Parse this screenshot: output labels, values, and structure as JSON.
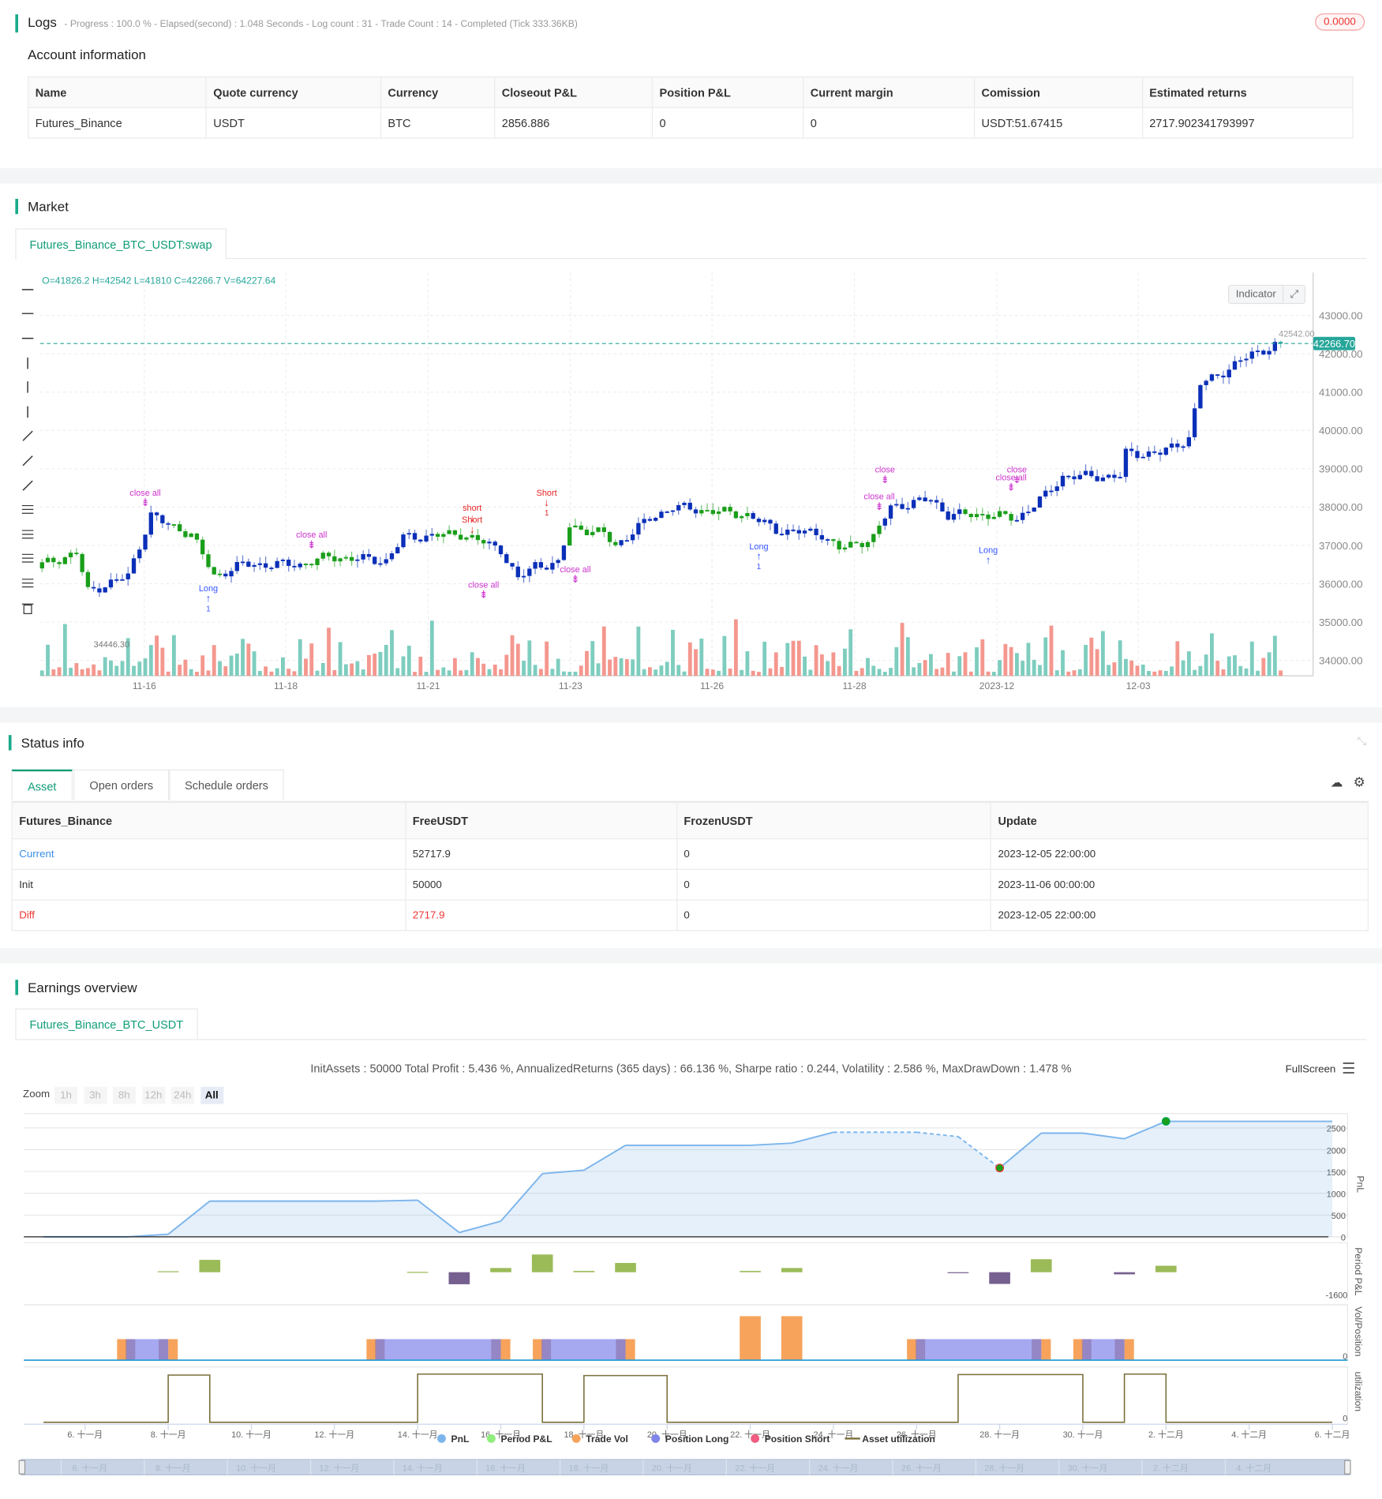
{
  "logs": {
    "title": "Logs",
    "summary": "- Progress : 100.0 % - Elapsed(second) : 1.048  Seconds - Log count : 31 - Trade Count : 14 - Completed (Tick 333.36KB)",
    "badge": "0.0000"
  },
  "account": {
    "title": "Account information",
    "headers": [
      "Name",
      "Quote currency",
      "Currency",
      "Closeout P&L",
      "Position P&L",
      "Current margin",
      "Comission",
      "Estimated returns"
    ],
    "row": [
      "Futures_Binance",
      "USDT",
      "BTC",
      "2856.886",
      "0",
      "0",
      "USDT:51.67415",
      "2717.902341793997"
    ]
  },
  "market": {
    "title": "Market",
    "tab": "Futures_Binance_BTC_USDT:swap",
    "ohlc": "O=41826.2 H=42542 L=41810 C=42266.7 V=64227.64",
    "indicator_label": "Indicator",
    "last_price": "42266.70",
    "high_label": "42542.00",
    "low_label": "34446.30",
    "price_ticks": [
      "43000.00",
      "42000.00",
      "41000.00",
      "40000.00",
      "39000.00",
      "38000.00",
      "37000.00",
      "36000.00",
      "35000.00",
      "34000.00"
    ],
    "date_ticks": [
      "11-16",
      "11-18",
      "11-21",
      "11-23",
      "11-26",
      "11-28",
      "2023-12",
      "12-03"
    ],
    "tools": [
      "horizontal-line-icon",
      "horizontal-ray-icon",
      "horizontal-segment-icon",
      "vertical-line-icon",
      "vertical-ray-icon",
      "vertical-segment-icon",
      "trend-line-icon",
      "trend-ray-icon",
      "trend-segment-icon",
      "price-range-icon",
      "parallel-channel-icon",
      "channel-icon",
      "fib-icon",
      "trash-icon"
    ],
    "colors": {
      "up": "#1a9e1a",
      "down": "#0a2fb8",
      "vol_up": "#7ecdbf",
      "vol_down": "#f4978e",
      "last": "#26a69a",
      "signal": "#cc33cc",
      "long": "#3355ff",
      "short": "#e52222"
    },
    "price_path": [
      [
        0,
        36500
      ],
      [
        6,
        36800
      ],
      [
        8,
        35800
      ],
      [
        15,
        36200
      ],
      [
        19,
        37800
      ],
      [
        21,
        37600
      ],
      [
        26,
        37300
      ],
      [
        30,
        36200
      ],
      [
        35,
        36500
      ],
      [
        45,
        36500
      ],
      [
        50,
        36700
      ],
      [
        60,
        36600
      ],
      [
        63,
        37200
      ],
      [
        73,
        37300
      ],
      [
        80,
        36900
      ],
      [
        83,
        36100
      ],
      [
        86,
        36500
      ],
      [
        90,
        36500
      ],
      [
        92,
        37500
      ],
      [
        98,
        37300
      ],
      [
        100,
        37000
      ],
      [
        106,
        37700
      ],
      [
        110,
        38000
      ],
      [
        123,
        37800
      ],
      [
        128,
        37400
      ],
      [
        136,
        37300
      ],
      [
        139,
        36900
      ],
      [
        145,
        37200
      ],
      [
        148,
        38000
      ],
      [
        155,
        38200
      ],
      [
        158,
        37800
      ],
      [
        165,
        37800
      ],
      [
        170,
        37700
      ],
      [
        175,
        38300
      ],
      [
        178,
        38800
      ],
      [
        188,
        38800
      ],
      [
        189,
        39400
      ],
      [
        195,
        39400
      ],
      [
        200,
        39800
      ],
      [
        202,
        41200
      ],
      [
        208,
        41700
      ],
      [
        211,
        42000
      ],
      [
        216,
        42266
      ]
    ],
    "markers": [
      {
        "i": 18,
        "p": 38300,
        "text": "close all",
        "kind": "signal"
      },
      {
        "i": 29,
        "p": 35800,
        "text": "Long",
        "kind": "long",
        "sub": "1"
      },
      {
        "i": 47,
        "p": 37200,
        "text": "close all",
        "kind": "signal"
      },
      {
        "i": 75,
        "p": 37900,
        "text": "short",
        "kind": "short"
      },
      {
        "i": 75,
        "p": 37600,
        "text": "Short",
        "kind": "short"
      },
      {
        "i": 77,
        "p": 35900,
        "text": "close all",
        "kind": "signal"
      },
      {
        "i": 88,
        "p": 38300,
        "text": "Short",
        "kind": "short",
        "sub": "1"
      },
      {
        "i": 93,
        "p": 36300,
        "text": "close all",
        "kind": "signal"
      },
      {
        "i": 125,
        "p": 36900,
        "text": "Long",
        "kind": "long",
        "sub": "1"
      },
      {
        "i": 147,
        "p": 38900,
        "text": "close",
        "kind": "signal"
      },
      {
        "i": 146,
        "p": 38200,
        "text": "close all",
        "kind": "signal"
      },
      {
        "i": 165,
        "p": 36800,
        "text": "Long",
        "kind": "long"
      },
      {
        "i": 170,
        "p": 38900,
        "text": "close",
        "kind": "signal"
      },
      {
        "i": 169,
        "p": 38700,
        "text": "close all",
        "kind": "signal"
      }
    ]
  },
  "status": {
    "title": "Status info",
    "tabs": [
      "Asset",
      "Open orders",
      "Schedule orders"
    ],
    "headers": [
      "Futures_Binance",
      "FreeUSDT",
      "FrozenUSDT",
      "Update"
    ],
    "rows": [
      [
        "Current",
        "52717.9",
        "0",
        "2023-12-05 22:00:00"
      ],
      [
        "Init",
        "50000",
        "0",
        "2023-11-06 00:00:00"
      ],
      [
        "Diff",
        "2717.9",
        "0",
        "2023-12-05 22:00:00"
      ]
    ]
  },
  "earnings": {
    "title": "Earnings overview",
    "tab": "Futures_Binance_BTC_USDT",
    "summary": "InitAssets : 50000 Total Profit : 5.436 %, AnnualizedReturns (365 days) : 66.136 %, Sharpe ratio : 0.244, Volatility : 2.586 %, MaxDrawDown : 1.478 %",
    "fullscreen": "FullScreen",
    "zoom_label": "Zoom",
    "zoom_options": [
      "1h",
      "3h",
      "8h",
      "12h",
      "24h",
      "All"
    ],
    "legend": [
      "PnL",
      "Period P&L",
      "Trade Vol",
      "Position Long",
      "Position Short",
      "Asset utilization"
    ]
  },
  "chart_data": {
    "type": "line",
    "x_unit": "day (Nov; >30 = Dec)",
    "x_ticks": [
      "6. 十一月",
      "8. 十一月",
      "10. 十一月",
      "12. 十一月",
      "14. 十一月",
      "16. 十一月",
      "18. 十一月",
      "20. 十一月",
      "22. 十一月",
      "24. 十一月",
      "26. 十一月",
      "28. 十一月",
      "30. 十一月",
      "2. 十二月",
      "4. 十二月",
      "6. 十二月"
    ],
    "pnl_axis": {
      "label": "PnL",
      "ticks": [
        "2500",
        "2000",
        "1500",
        "1000",
        "500",
        "0"
      ],
      "ylim": [
        0,
        2800
      ]
    },
    "pnl": [
      [
        5,
        0
      ],
      [
        7,
        0
      ],
      [
        8,
        60
      ],
      [
        9,
        820
      ],
      [
        13,
        820
      ],
      [
        14,
        840
      ],
      [
        15,
        100
      ],
      [
        16,
        360
      ],
      [
        17,
        1450
      ],
      [
        18,
        1530
      ],
      [
        19,
        2100
      ],
      [
        22,
        2100
      ],
      [
        23,
        2150
      ],
      [
        24,
        2400
      ],
      [
        26,
        2400
      ],
      [
        27,
        2300
      ],
      [
        28,
        1580
      ],
      [
        29,
        2380
      ],
      [
        30,
        2380
      ],
      [
        31,
        2250
      ],
      [
        32,
        2650
      ],
      [
        36,
        2650
      ]
    ],
    "period_axis": {
      "label": "Period P&L",
      "ticks": [
        "-1600"
      ]
    },
    "period_pnl": [
      [
        8,
        60
      ],
      [
        9,
        760
      ],
      [
        14,
        20
      ],
      [
        15,
        -740
      ],
      [
        16,
        260
      ],
      [
        17,
        1090
      ],
      [
        18,
        80
      ],
      [
        19,
        570
      ],
      [
        22,
        80
      ],
      [
        23,
        260
      ],
      [
        27,
        -50
      ],
      [
        28,
        -720
      ],
      [
        29,
        800
      ],
      [
        31,
        -130
      ],
      [
        32,
        400
      ]
    ],
    "vol_axis": {
      "label": "Vol/Position",
      "ticks": [
        "0"
      ]
    },
    "positions_long": [
      [
        7,
        8
      ],
      [
        13,
        16
      ],
      [
        17,
        19
      ],
      [
        26,
        29
      ],
      [
        30,
        31
      ]
    ],
    "trade_vol_single": [
      22,
      23
    ],
    "util_axis": {
      "label": "utilization",
      "ticks": [
        "0"
      ]
    },
    "utilization": [
      [
        8,
        9,
        0.95
      ],
      [
        14,
        17,
        0.97
      ],
      [
        18,
        20,
        0.94
      ],
      [
        27,
        30,
        0.96
      ],
      [
        31,
        32,
        0.97
      ]
    ],
    "colors": {
      "pnl": "#7cb5ec",
      "period_up": "#9bbb59",
      "period_down": "#76608f",
      "vol": "#f7a35c",
      "long": "#8085e9",
      "short": "#f15c80",
      "util": "#7a6f3a"
    }
  }
}
